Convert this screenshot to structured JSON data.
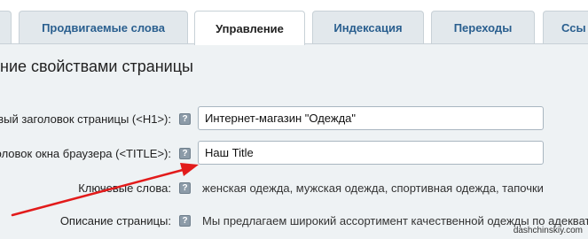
{
  "tabs": [
    {
      "label": "",
      "active": false
    },
    {
      "label": "Продвигаемые слова",
      "active": false
    },
    {
      "label": "Управление",
      "active": true
    },
    {
      "label": "Индексация",
      "active": false
    },
    {
      "label": "Переходы",
      "active": false
    },
    {
      "label": "Ссы",
      "active": false
    }
  ],
  "section": {
    "title": "ние свойствами страницы"
  },
  "fields": {
    "h1": {
      "label": "вый заголовок страницы (<H1>):",
      "value": "Интернет-магазин \"Одежда\""
    },
    "title": {
      "label": "головок окна браузера (<TITLE>):",
      "value": "Наш Title"
    },
    "keywords": {
      "label": "Ключевые слова:",
      "value": "женская одежда, мужская одежда, спортивная одежда, тапочки"
    },
    "description": {
      "label": "Описание страницы:",
      "value": "Мы предлагаем широкий ассортимент качественной одежды по адекват"
    }
  },
  "help_icon_text": "?",
  "watermark": "dashchinskiy.com",
  "colors": {
    "arrow": "#e21b1b",
    "tab_text": "#2a5f8f",
    "panel_bg": "#eef2f4"
  }
}
